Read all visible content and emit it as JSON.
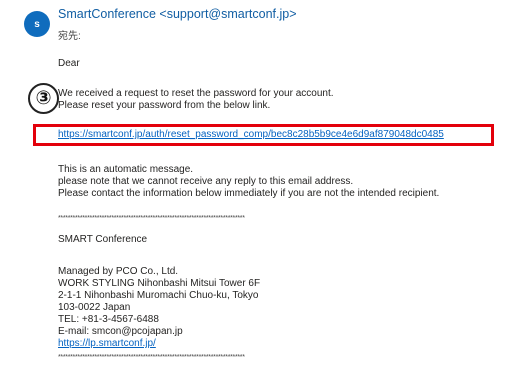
{
  "email": {
    "avatar_letter": "s",
    "sender": "SmartConference <support@smartconf.jp>",
    "to_label": "宛先:",
    "greeting": "Dear",
    "request_line1": "We received a request to reset the password for your account.",
    "request_line2": "Please reset your password from the below link.",
    "reset_link": "https://smartconf.jp/auth/reset_password_comp/bec8c28b5b9ce4e6d9af879048dc0485",
    "auto_line1": "This is an automatic message.",
    "auto_line2": "please note that we cannot receive any reply to this email address.",
    "auto_line3": "Please contact the information below immediately if you are not the intended recipient.",
    "separator": "*****************************************************************************",
    "org_name": "SMART Conference",
    "managed_by": "Managed by PCO Co., Ltd.",
    "address1": "WORK STYLING Nihonbashi Mitsui Tower 6F",
    "address2": "2-1-1 Nihonbashi Muromachi Chuo-ku, Tokyo",
    "postal": "103-0022 Japan",
    "tel": "TEL: +81-3-4567-6488",
    "email_line": "E-mail: smcon@pcojapan.jp",
    "website": "https://lp.smartconf.jp/"
  },
  "annotation": {
    "step_number": "③",
    "highlight_color": "#e3000b"
  },
  "colors": {
    "avatar_bg": "#0f6cbd",
    "sender": "#115ea3",
    "link": "#0563c1"
  }
}
